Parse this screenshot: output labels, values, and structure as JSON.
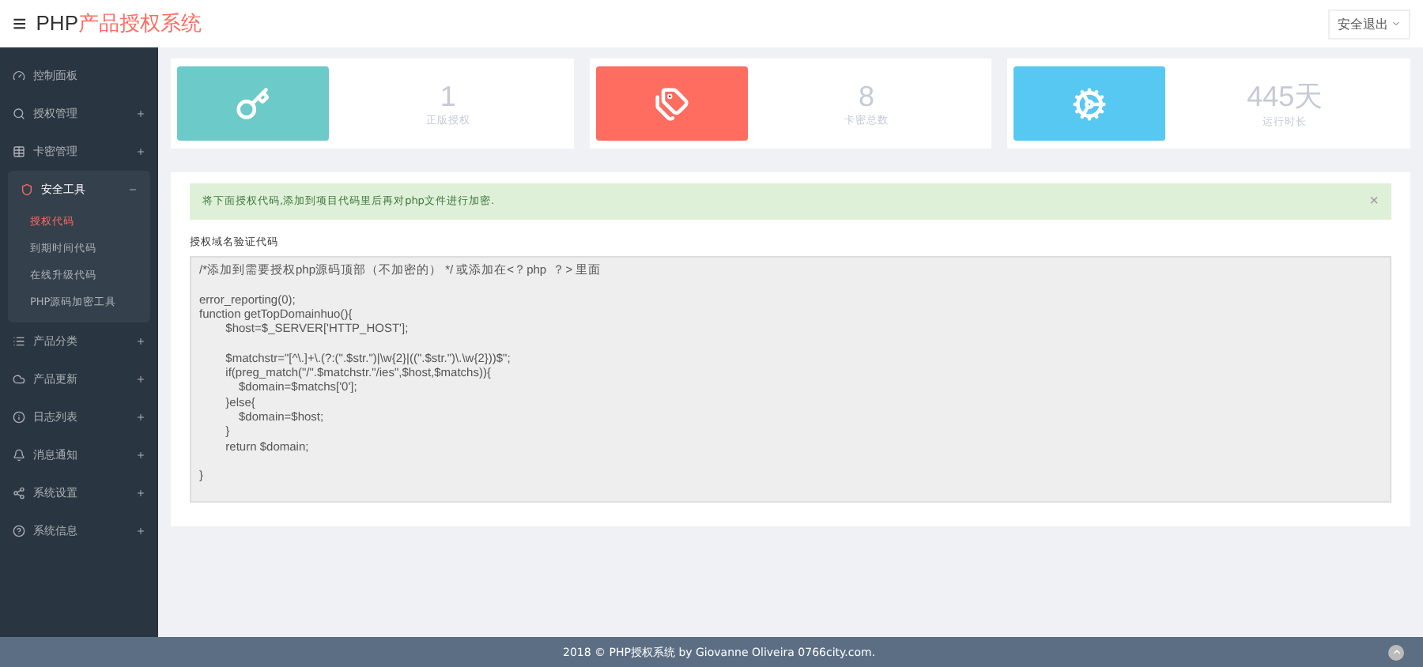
{
  "header": {
    "menu_icon": "≡",
    "brand_prefix": "PHP",
    "brand_suffix": "产品授权系统",
    "user_menu": "安全退出"
  },
  "sidebar": {
    "items": [
      {
        "label": "控制面板"
      },
      {
        "label": "授权管理",
        "expanded": false
      },
      {
        "label": "卡密管理",
        "expanded": false
      },
      {
        "label": "安全工具",
        "expanded": true,
        "children": [
          {
            "label": "授权代码",
            "selected": true
          },
          {
            "label": "到期时间代码",
            "selected": false
          },
          {
            "label": "在线升级代码",
            "selected": false
          },
          {
            "label": "PHP源码加密工具",
            "selected": false
          }
        ]
      },
      {
        "label": "产品分类",
        "expanded": false
      },
      {
        "label": "产品更新",
        "expanded": false
      },
      {
        "label": "日志列表",
        "expanded": false
      },
      {
        "label": "消息通知",
        "expanded": false
      },
      {
        "label": "系统设置",
        "expanded": false
      },
      {
        "label": "系统信息",
        "expanded": false
      }
    ]
  },
  "stats": [
    {
      "color": "#6ccac9",
      "value": "1",
      "label": "正版授权"
    },
    {
      "color": "#ff6c60",
      "value": "8",
      "label": "卡密总数"
    },
    {
      "color": "#57c8f2",
      "value": "445天",
      "label": "运行时长"
    }
  ],
  "alert": {
    "text": "将下面授权代码,添加到项目代码里后再对php文件进行加密.",
    "close": "×"
  },
  "code": {
    "label": "授权域名验证代码",
    "blocks": [
      [
        "/*添加到需要授权php源码顶部（不加密的） */ 或添加在<？php  ？> 里面"
      ],
      [
        "error_reporting(0);",
        "function getTopDomainhuo(){",
        "\t\t$host=$_SERVER['HTTP_HOST'];"
      ],
      [
        "\t\t$matchstr=\"[^\\.]+\\.(?:(\".$str.\")|\\w{2}|((\".$str.\")\\.\\w{2}))$\";",
        "\t\tif(preg_match(\"/\".$matchstr.\"/ies\",$host,$matchs)){",
        "\t\t\t$domain=$matchs['0'];",
        "\t\t}else{",
        "\t\t\t$domain=$host;",
        "\t\t}",
        "\t\treturn $domain;"
      ],
      [
        "}"
      ]
    ]
  },
  "footer": {
    "text": "2018 © PHP授权系统 by Giovanne Oliveira 0766city.com."
  }
}
